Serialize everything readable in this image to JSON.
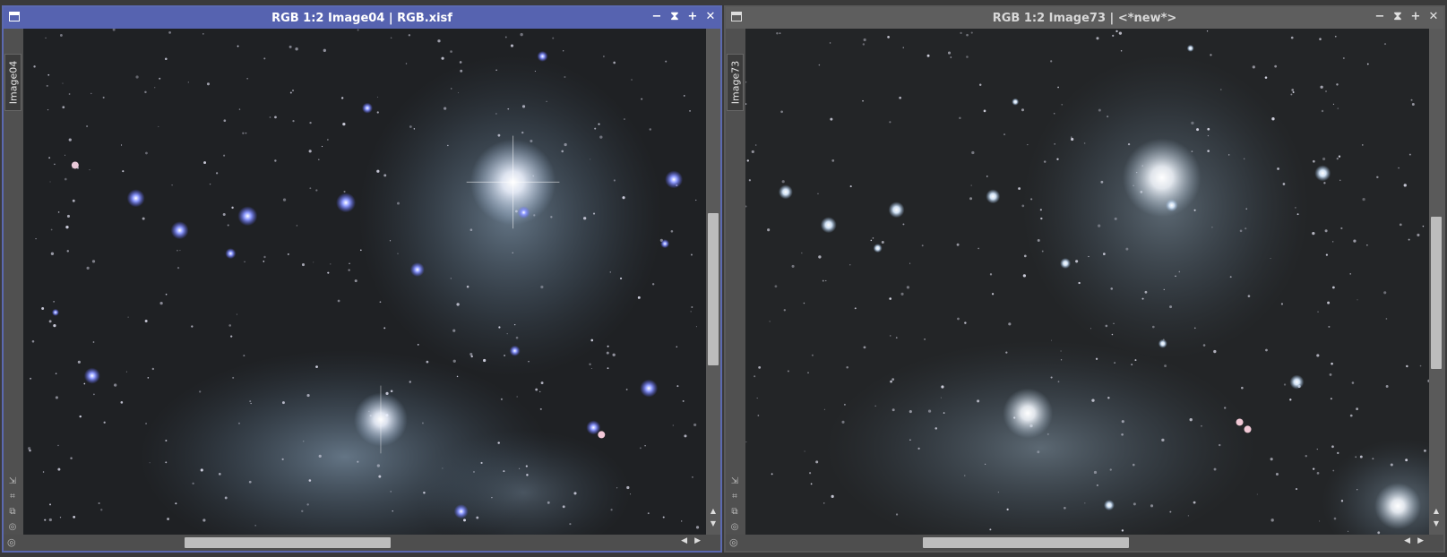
{
  "windows": [
    {
      "title": "RGB 1:2 Image04 | RGB.xisf",
      "tab_label": "Image04",
      "state": "active"
    },
    {
      "title": "RGB 1:2 Image73 | <*new*>",
      "tab_label": "Image73",
      "state": "inactive"
    }
  ],
  "controls": {
    "minimize": "−",
    "shade": "⧗",
    "maximize": "+",
    "close": "✕"
  },
  "colors": {
    "active_title": "#5663b0",
    "inactive_title": "#5e5e5e",
    "sky": "#1e2023",
    "nebula": "#8fb0cc",
    "hot_star": "#7a8cff"
  },
  "icons": [
    "fit-view-icon",
    "zoom-icon",
    "clone-icon",
    "settings-icon",
    "scroll-left-icon",
    "scroll-right-icon",
    "scroll-up-icon",
    "scroll-down-icon"
  ]
}
